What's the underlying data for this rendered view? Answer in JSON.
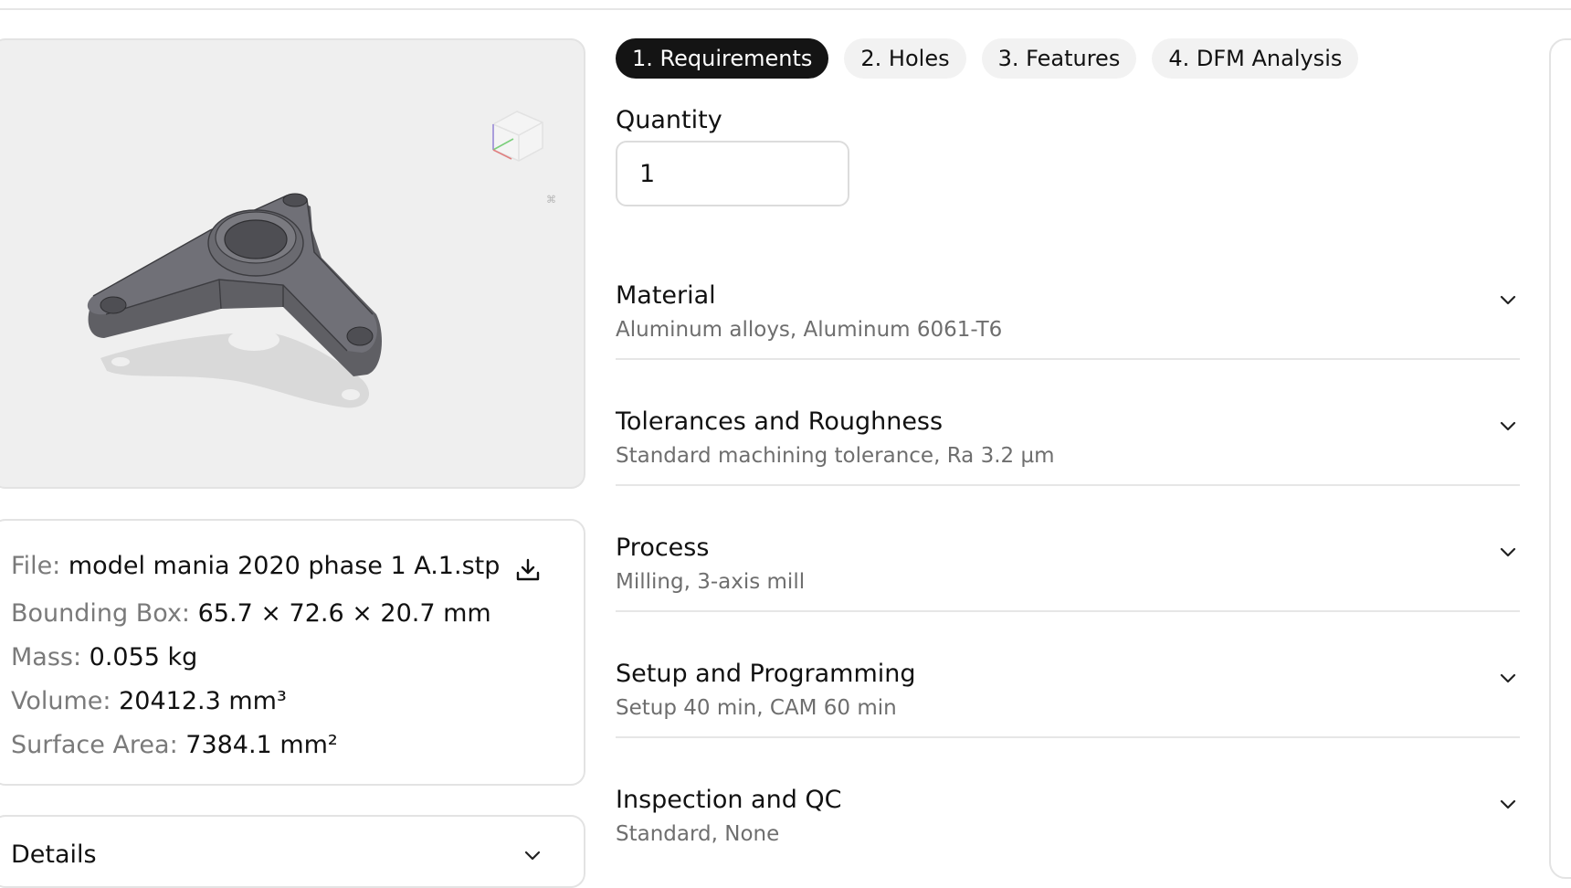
{
  "colors": {
    "accent": "#141414",
    "muted_text": "#6e6e6e",
    "border": "#e3e3e3",
    "viewer_bg": "#efefef",
    "part_fill": "#5f5f64"
  },
  "tabs": [
    {
      "label": "1. Requirements",
      "active": true
    },
    {
      "label": "2. Holes",
      "active": false
    },
    {
      "label": "3. Features",
      "active": false
    },
    {
      "label": "4. DFM Analysis",
      "active": false
    }
  ],
  "quantity": {
    "label": "Quantity",
    "value": "1"
  },
  "sections": [
    {
      "title": "Material",
      "summary": "Aluminum alloys, Aluminum 6061-T6",
      "icon": "chevron-down-icon"
    },
    {
      "title": "Tolerances and Roughness",
      "summary": "Standard machining tolerance, Ra 3.2 µm",
      "icon": "chevron-down-icon"
    },
    {
      "title": "Process",
      "summary": "Milling, 3-axis mill",
      "icon": "chevron-down-icon"
    },
    {
      "title": "Setup and Programming",
      "summary": "Setup 40 min, CAM 60 min",
      "icon": "chevron-down-icon"
    },
    {
      "title": "Inspection and QC",
      "summary": "Standard, None",
      "icon": "chevron-down-icon"
    }
  ],
  "file_info": {
    "file_label": "File:",
    "file_value": "model mania 2020 phase 1 A.1.stp",
    "bbox_label": "Bounding Box:",
    "bbox_value": "65.7 × 72.6 × 20.7 mm",
    "mass_label": "Mass:",
    "mass_value": "0.055 kg",
    "volume_label": "Volume:",
    "volume_value": "20412.3 mm³",
    "area_label": "Surface Area:",
    "area_value": "7384.1 mm²",
    "download_icon": "download-icon"
  },
  "details": {
    "title": "Details",
    "icon": "chevron-down-icon"
  },
  "viewer": {
    "cube_icon": "view-cube-icon",
    "corner_mark": "⌘"
  }
}
